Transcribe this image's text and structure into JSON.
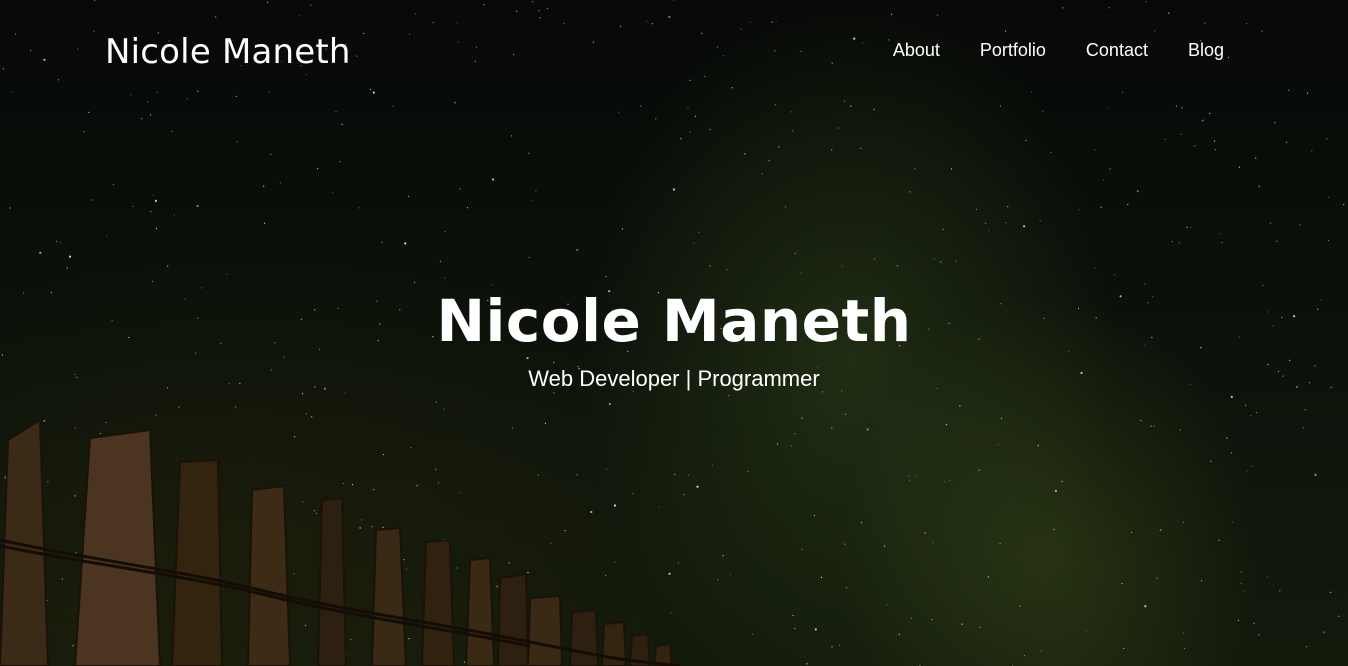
{
  "header": {
    "brand": "Nicole Maneth",
    "nav": [
      {
        "label": "About"
      },
      {
        "label": "Portfolio"
      },
      {
        "label": "Contact"
      },
      {
        "label": "Blog"
      }
    ]
  },
  "hero": {
    "title": "Nicole Maneth",
    "subtitle": "Web Developer | Programmer",
    "background": "night-sky-with-milky-way-and-wooden-fence"
  },
  "colors": {
    "text": "#ffffff",
    "sky": "#070907",
    "milky_way": "#5a6e28"
  }
}
